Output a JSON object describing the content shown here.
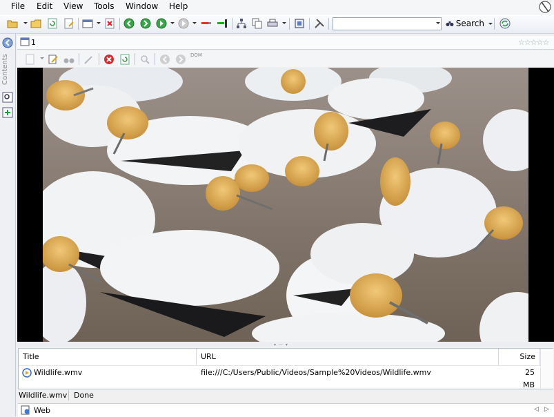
{
  "menu": {
    "items": [
      "File",
      "Edit",
      "View",
      "Tools",
      "Window",
      "Help"
    ]
  },
  "toolbar": {
    "search_label": "Search",
    "search_value": "",
    "icons": [
      "open-folder-icon",
      "folder-icon",
      "refresh-icon",
      "edit-page-icon",
      "new-window-icon",
      "stop-icon",
      "back-icon",
      "forward-icon",
      "play-icon",
      "next-icon",
      "bookmark-remove-icon",
      "bookmark-add-icon",
      "sitemap-icon",
      "copy-icon",
      "print-icon",
      "fullscreen-icon",
      "tools-icon",
      "binoculars-icon",
      "sync-icon"
    ]
  },
  "sidebar": {
    "label": "Contents"
  },
  "tab": {
    "number": "1",
    "rating": "☆☆☆☆☆"
  },
  "innertoolbar": {
    "dom_label": "DOM"
  },
  "table": {
    "columns": [
      "Title",
      "URL",
      "Size"
    ],
    "rows": [
      {
        "title": "Wildlife.wmv",
        "url": "file:///C:/Users/Public/Videos/Sample%20Videos/Wildlife.wmv",
        "size": "25 MB"
      }
    ]
  },
  "status": {
    "file": "Wildlife.wmv",
    "state": "Done"
  },
  "bottomtabs": {
    "web": "Web"
  },
  "colors": {
    "toolbar_bg": "#e9edf3",
    "video_bg": "#000000",
    "bird_white": "#f2f3f5",
    "bird_head": "#e6b55a"
  }
}
